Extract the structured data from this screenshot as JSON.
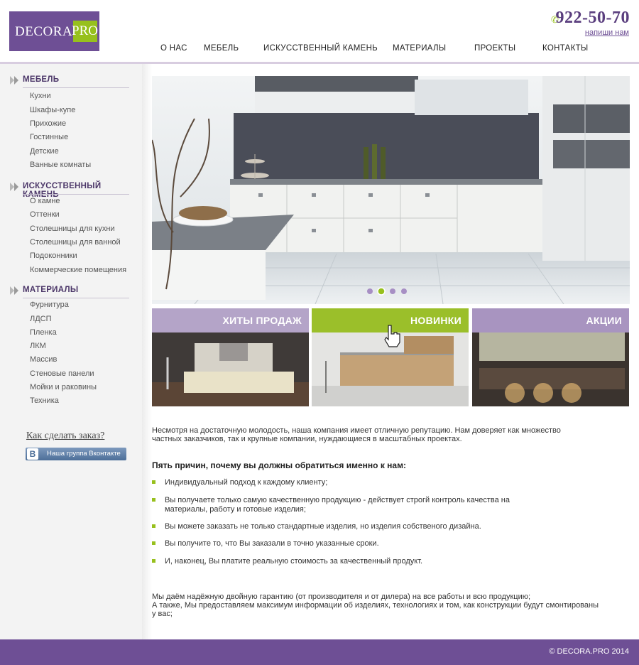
{
  "header": {
    "logo_left": "DECORA.",
    "logo_right": "PRO",
    "phone": "922-50-70",
    "write_us": "напиши нам",
    "nav": [
      "О НАС",
      "МЕБЕЛЬ",
      "ИСКУССТВЕННЫЙ КАМЕНЬ",
      "МАТЕРИАЛЫ",
      "ПРОЕКТЫ",
      "КОНТАКТЫ"
    ]
  },
  "sidebar": {
    "categories": [
      {
        "title": "МЕБЕЛЬ",
        "items": [
          "Кухни",
          "Шкафы-купе",
          "Прихожие",
          "Гостинные",
          "Детские",
          "Ванные комнаты"
        ]
      },
      {
        "title": "ИСКУССТВЕННЫЙ КАМЕНЬ",
        "items": [
          "О камне",
          "Оттенки",
          "Столешницы для кухни",
          "Столешницы для ванной",
          "Подоконники",
          "Коммерческие помещения"
        ]
      },
      {
        "title": "МАТЕРИАЛЫ",
        "items": [
          "Фурнитура",
          "ЛДСП",
          "Пленка",
          "ЛКМ",
          "Массив",
          "Стеновые панели",
          "Мойки и раковины",
          "Техника"
        ]
      }
    ],
    "how_to_order": "Как сделать заказ?",
    "vk_logo": "B",
    "vk_label": "Наша группа Вконтакте"
  },
  "slider": {
    "dots": 4,
    "active_dot": 2
  },
  "promos": [
    {
      "title": "ХИТЫ ПРОДАЖ",
      "color": "#b4a4c8"
    },
    {
      "title": "НОВИНКИ",
      "color": "#9bbf2a"
    },
    {
      "title": "АКЦИИ",
      "color": "#a894c0"
    }
  ],
  "content": {
    "intro": "Несмотря на достаточную молодость, наша компания имеет отличную репутацию. Нам доверяет как множество частных заказчиков, так и крупные компании, нуждающиеся в масштабных проектах.",
    "reasons_title": "Пять причин, почему вы должны обратиться именно к нам:",
    "reasons": [
      "Индивидуальный подход к каждому клиенту;",
      "Вы получаете только самую качественную продукцию - действует строгй контроль качества на материалы, работу и готовые изделия;",
      "Вы можете заказать не только стандартные изделия, но изделия собственого дизайна.",
      "Вы получите то, что Вы заказали в точно указанные сроки.",
      "И, наконец, Вы платите реальную стоимость за качественный продукт."
    ],
    "guarantee_1": "Мы даём надёжную двойную гарантию (от производителя и от дилера) на все работы и всю продукцию;",
    "guarantee_2": "А также, Мы предоставляем максимум информации об изделиях, технологиях и том, как конструкции будут смонтированы у вас;"
  },
  "footer": {
    "copyright": "© DECORA.PRO 2014"
  },
  "colors": {
    "brand_purple": "#6e4f95",
    "brand_green": "#97c01d"
  }
}
